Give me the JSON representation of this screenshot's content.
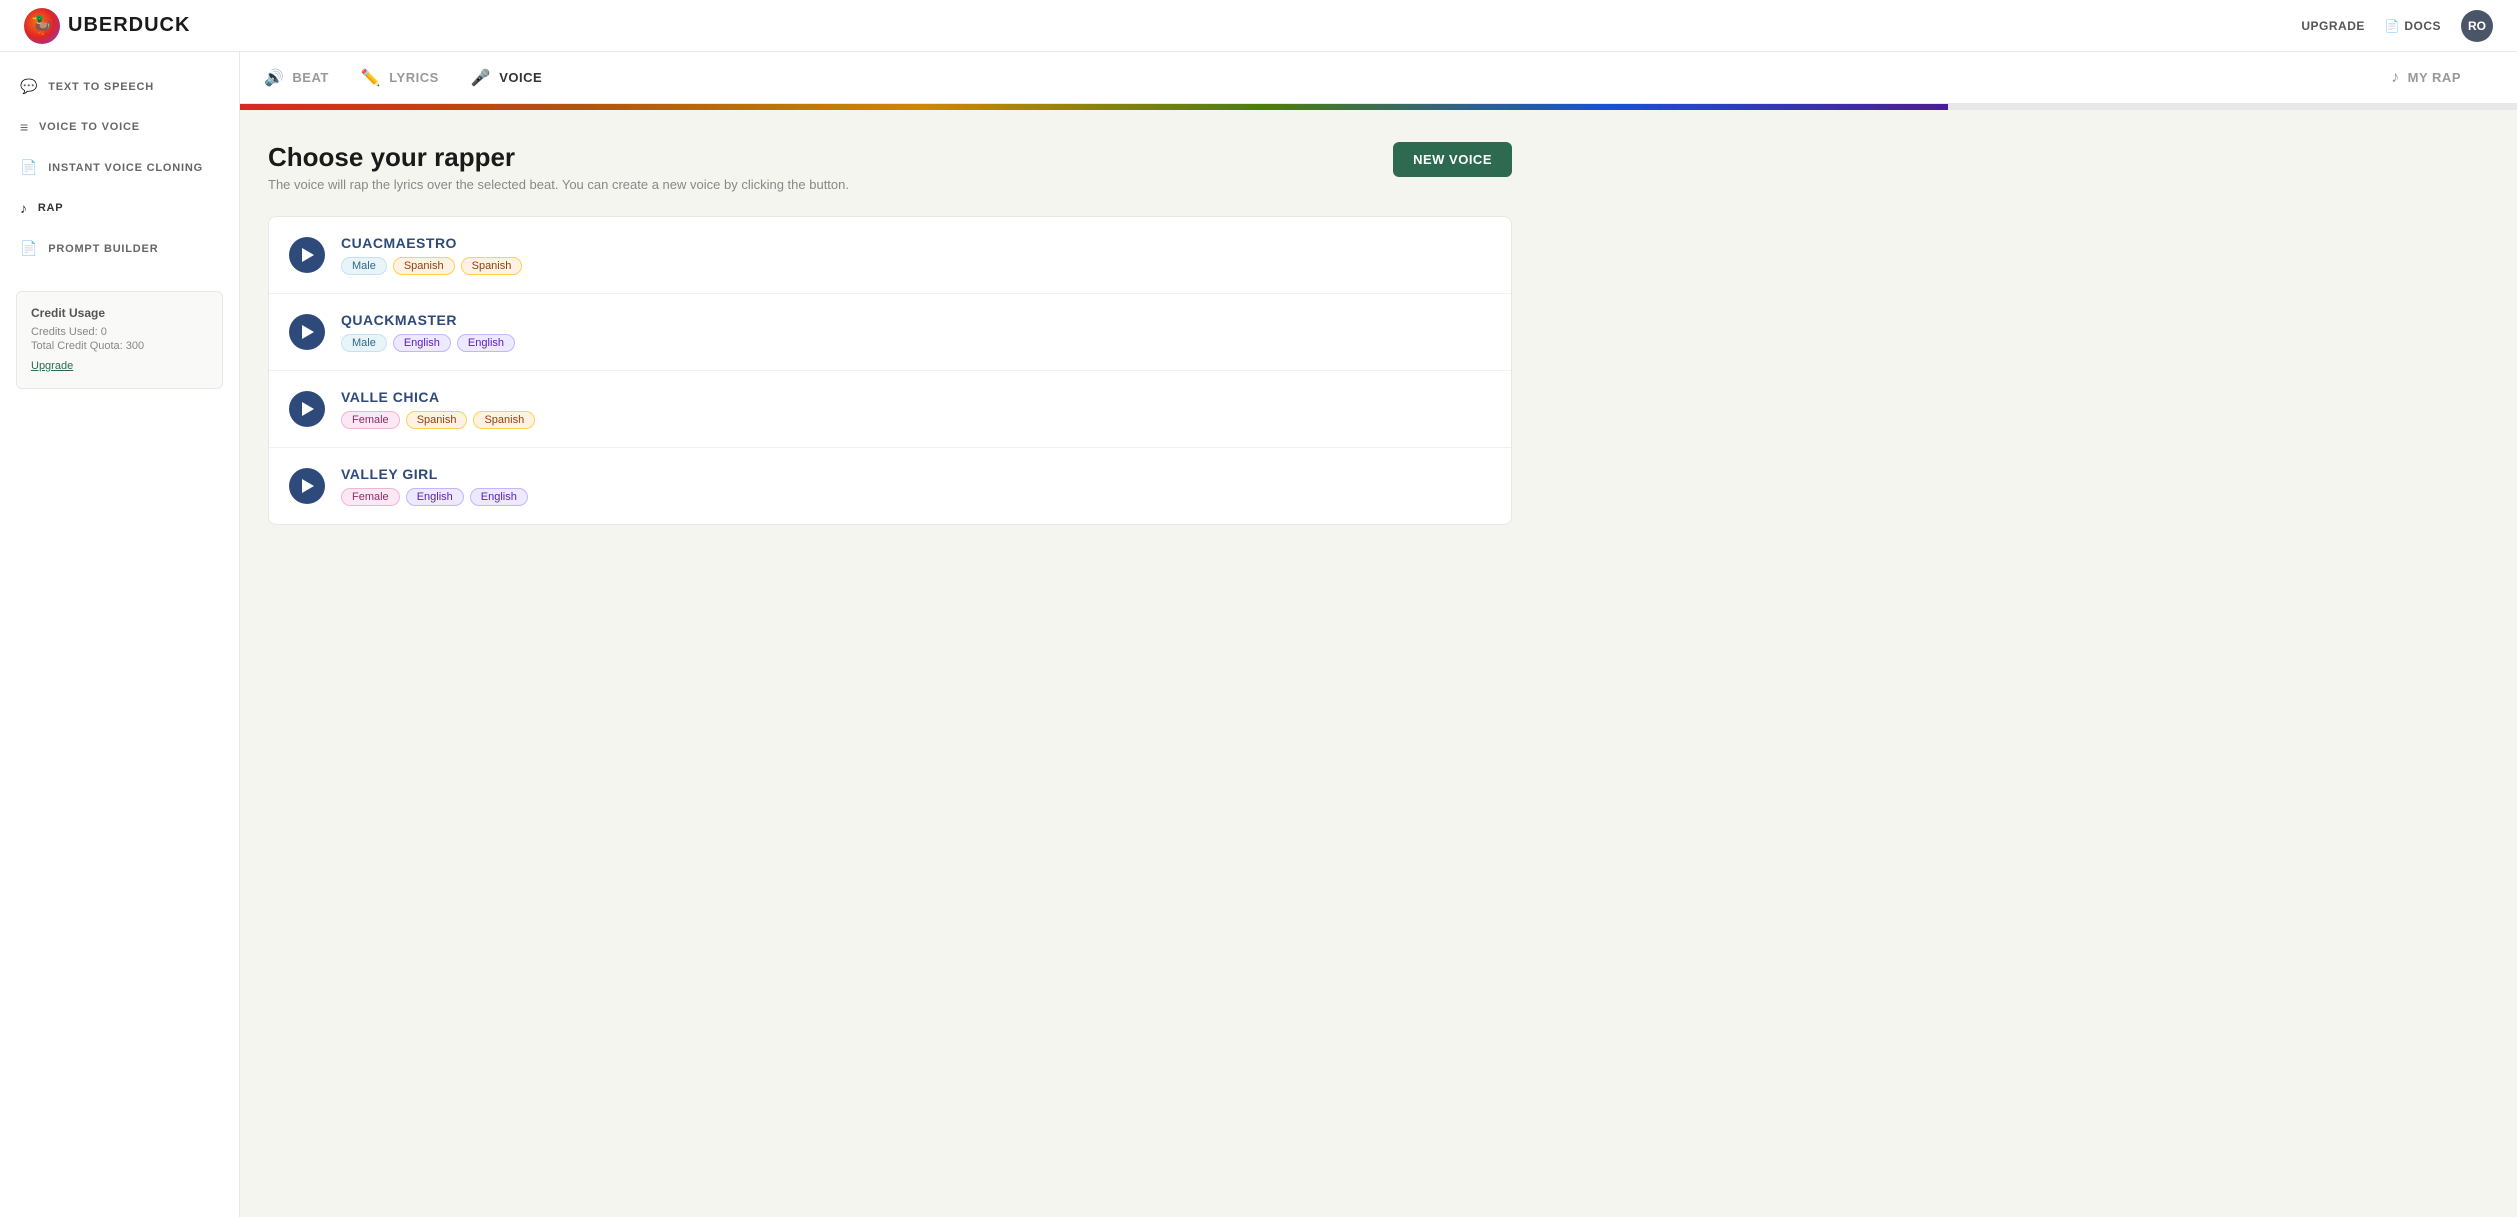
{
  "topnav": {
    "logo_text": "UBERDUCK",
    "logo_emoji": "🦆",
    "upgrade_label": "UPGRADE",
    "docs_label": "DOCS",
    "avatar_initials": "RO"
  },
  "sidebar": {
    "items": [
      {
        "id": "text-to-speech",
        "label": "TEXT TO SPEECH",
        "icon": "💬"
      },
      {
        "id": "voice-to-voice",
        "label": "VOICE TO VOICE",
        "icon": "≡"
      },
      {
        "id": "instant-voice-cloning",
        "label": "INSTANT VOICE CLONING",
        "icon": "📄"
      },
      {
        "id": "rap",
        "label": "RAP",
        "icon": "♪",
        "active": true
      },
      {
        "id": "prompt-builder",
        "label": "PROMPT BUILDER",
        "icon": "📄"
      }
    ],
    "credit_usage": {
      "title": "Credit Usage",
      "credits_used_label": "Credits Used: 0",
      "total_quota_label": "Total Credit Quota: 300",
      "upgrade_label": "Upgrade"
    }
  },
  "steps": [
    {
      "id": "beat",
      "label": "BEAT",
      "icon": "🔊"
    },
    {
      "id": "lyrics",
      "label": "LYRICS",
      "icon": "✏️"
    },
    {
      "id": "voice",
      "label": "VOICE",
      "icon": "🎤",
      "active": true
    },
    {
      "id": "my-rap",
      "label": "MY RAP",
      "icon": "♪"
    }
  ],
  "progress": {
    "percent": 75
  },
  "content": {
    "title": "Choose your rapper",
    "subtitle": "The voice will rap the lyrics over the selected beat. You can create a new voice by clicking the button.",
    "new_voice_button": "NEW VOICE"
  },
  "voices": [
    {
      "name": "CUACMAESTRO",
      "tags": [
        {
          "label": "Male",
          "type": "male"
        },
        {
          "label": "Spanish",
          "type": "spanish"
        },
        {
          "label": "Spanish",
          "type": "spanish"
        }
      ]
    },
    {
      "name": "QUACKMASTER",
      "tags": [
        {
          "label": "Male",
          "type": "male"
        },
        {
          "label": "English",
          "type": "english"
        },
        {
          "label": "English",
          "type": "english"
        }
      ]
    },
    {
      "name": "VALLE CHICA",
      "tags": [
        {
          "label": "Female",
          "type": "female"
        },
        {
          "label": "Spanish",
          "type": "spanish"
        },
        {
          "label": "Spanish",
          "type": "spanish"
        }
      ]
    },
    {
      "name": "VALLEY GIRL",
      "tags": [
        {
          "label": "Female",
          "type": "female"
        },
        {
          "label": "English",
          "type": "english"
        },
        {
          "label": "English",
          "type": "english"
        }
      ]
    }
  ]
}
